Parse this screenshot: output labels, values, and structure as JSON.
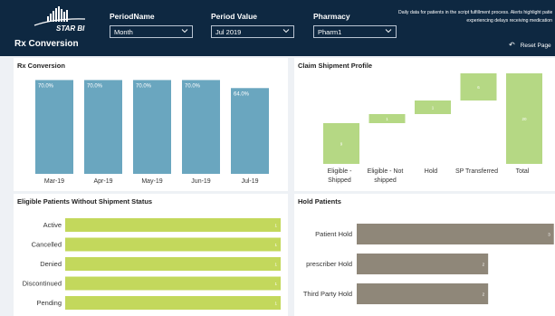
{
  "header": {
    "brand": "STAR BI",
    "app_title": "Rx Conversion",
    "filters": [
      {
        "label": "PeriodName",
        "value": "Month"
      },
      {
        "label": "Period Value",
        "value": "Jul 2019"
      },
      {
        "label": "Pharmacy",
        "value": "Pharm1"
      }
    ],
    "info_line1": "Daily data for patients in the script fulfillment process. Alerts highlight patients",
    "info_line2": "experiencing delays receiving medication",
    "reset_label": "Reset Page"
  },
  "panels": {
    "rx_conversion": {
      "title": "Rx Conversion",
      "chart_data": {
        "type": "bar",
        "categories": [
          "Mar-19",
          "Apr-19",
          "May-19",
          "Jun-19",
          "Jul-19"
        ],
        "values": [
          70.0,
          70.0,
          70.0,
          70.0,
          64.0
        ],
        "data_labels": [
          "70.0%",
          "70.0%",
          "70.0%",
          "70.0%",
          "64.0%"
        ],
        "ylim": [
          0,
          75
        ],
        "color": "#6aa6bf"
      }
    },
    "claim_shipment": {
      "title": "Claim Shipment Profile",
      "chart_data": {
        "type": "bar",
        "subtype": "waterfall",
        "categories": [
          "Eligible - Shipped",
          "Eligible - Not shipped",
          "Hold",
          "SP Transferred",
          "Total"
        ],
        "category_lines": [
          [
            "Eligible -",
            "Shipped"
          ],
          [
            "Eligible - Not",
            "shipped"
          ],
          [
            "Hold"
          ],
          [
            "SP Transferred"
          ],
          [
            "Total"
          ]
        ],
        "values": [
          9,
          2,
          3,
          6,
          20
        ],
        "data_labels": [
          "9",
          "1",
          "1",
          "6",
          "20"
        ],
        "ylim": [
          0,
          20
        ],
        "color": "#b5d884"
      }
    },
    "eligible_without_status": {
      "title": "Eligible Patients Without Shipment Status",
      "chart_data": {
        "type": "bar",
        "orientation": "horizontal",
        "categories": [
          "Active",
          "Cancelled",
          "Denied",
          "Discontinued",
          "Pending"
        ],
        "values": [
          1,
          1,
          1,
          1,
          1
        ],
        "data_labels": [
          "1",
          "1",
          "1",
          "1",
          "1"
        ],
        "xlim": [
          0,
          1
        ],
        "color": "#c3d85c"
      }
    },
    "hold_patients": {
      "title": "Hold Patients",
      "chart_data": {
        "type": "bar",
        "orientation": "horizontal",
        "categories": [
          "Patient Hold",
          "prescriber Hold",
          "Third Party Hold"
        ],
        "values": [
          3,
          2,
          2
        ],
        "data_labels": [
          "3",
          "2",
          "2"
        ],
        "xlim": [
          0,
          3.1
        ],
        "color": "#8f8779"
      }
    }
  }
}
